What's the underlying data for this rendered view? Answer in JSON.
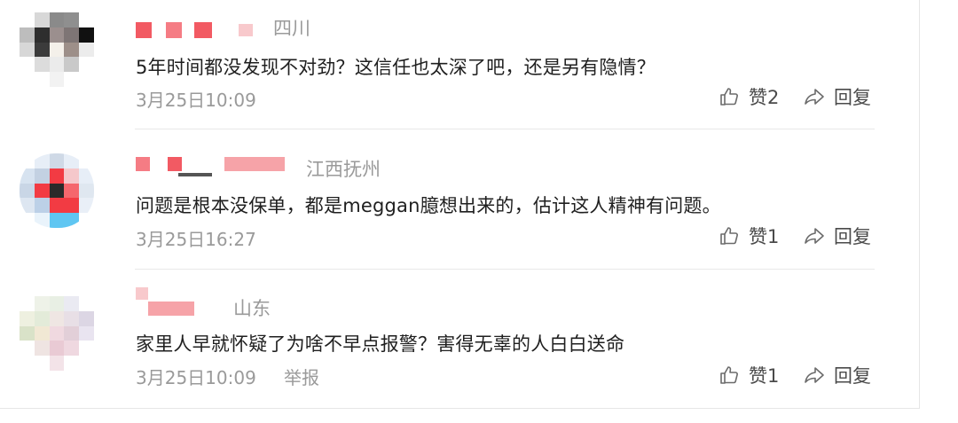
{
  "comments": [
    {
      "location": "四川",
      "text": "5年时间都没发现不对劲？这信任也太深了吧，还是另有隐情？",
      "time": "3月25日10:09",
      "like_label": "赞2",
      "reply_label": "回复"
    },
    {
      "location": "江西抚州",
      "text": "问题是根本没保单，都是meggan臆想出来的，估计这人精神有问题。",
      "time": "3月25日16:27",
      "like_label": "赞1",
      "reply_label": "回复"
    },
    {
      "location": "山东",
      "text": "家里人早就怀疑了为啥不早点报警？害得无辜的人白白送命",
      "time": "3月25日10:09",
      "report_label": "举报",
      "like_label": "赞1",
      "reply_label": "回复"
    }
  ],
  "colors": {
    "masked_name": "#f25a63",
    "meta_text": "#9a9a9a",
    "body_text": "#1f1f1f"
  },
  "icons": {
    "like": "thumbs-up-icon",
    "reply": "reply-arrow-icon"
  }
}
